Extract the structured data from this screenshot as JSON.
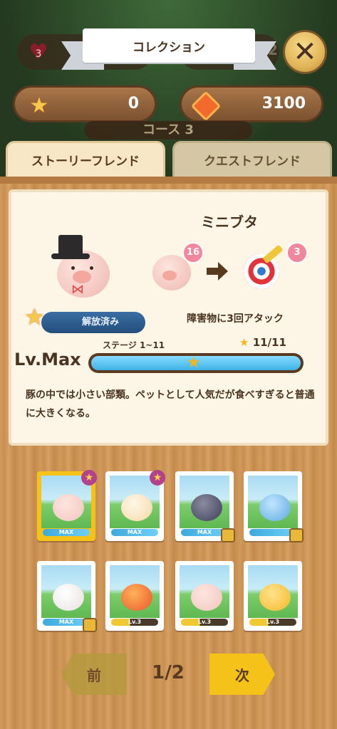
{
  "header": {
    "title": "コレクション",
    "close_label": "✕",
    "bg_lives": "3",
    "bg_right_value": "2",
    "course_label": "コース 3"
  },
  "currency": {
    "keys": "0",
    "gems": "3100"
  },
  "tabs": [
    {
      "label": "ストーリーフレンド",
      "active": true
    },
    {
      "label": "クエストフレンド",
      "active": false
    }
  ],
  "friend": {
    "name": "ミニブタ",
    "goal_count": "16",
    "attack_count": "3",
    "task_text": "障害物に3回アタック",
    "unlock_label": "解放済み",
    "stage_label": "ステージ 1~11",
    "stars": "11/11",
    "level_label": "Lv.Max",
    "level_fill": 1.0,
    "description": "豚の中では小さい部類。ペットとして人気だが食べすぎると普通に大きくなる。"
  },
  "grid": [
    {
      "level": "MAX",
      "selected": true,
      "locked": false,
      "star": true
    },
    {
      "level": "MAX",
      "selected": false,
      "locked": false,
      "star": true
    },
    {
      "level": "MAX",
      "selected": false,
      "locked": true,
      "star": false
    },
    {
      "level": "",
      "selected": false,
      "locked": true,
      "star": false
    },
    {
      "level": "MAX",
      "selected": false,
      "locked": true,
      "star": false
    },
    {
      "level": "Lv.3",
      "selected": false,
      "locked": false,
      "star": false
    },
    {
      "level": "Lv.3",
      "selected": false,
      "locked": false,
      "star": false
    },
    {
      "level": "Lv.3",
      "selected": false,
      "locked": false,
      "star": false
    }
  ],
  "pagination": {
    "prev_label": "前",
    "next_label": "次",
    "page": "1/2"
  },
  "colors": {
    "accent_yellow": "#f5c21a",
    "wood": "#d19a5c",
    "text_brown": "#4a3420",
    "level_blue": "#3db2e6"
  }
}
